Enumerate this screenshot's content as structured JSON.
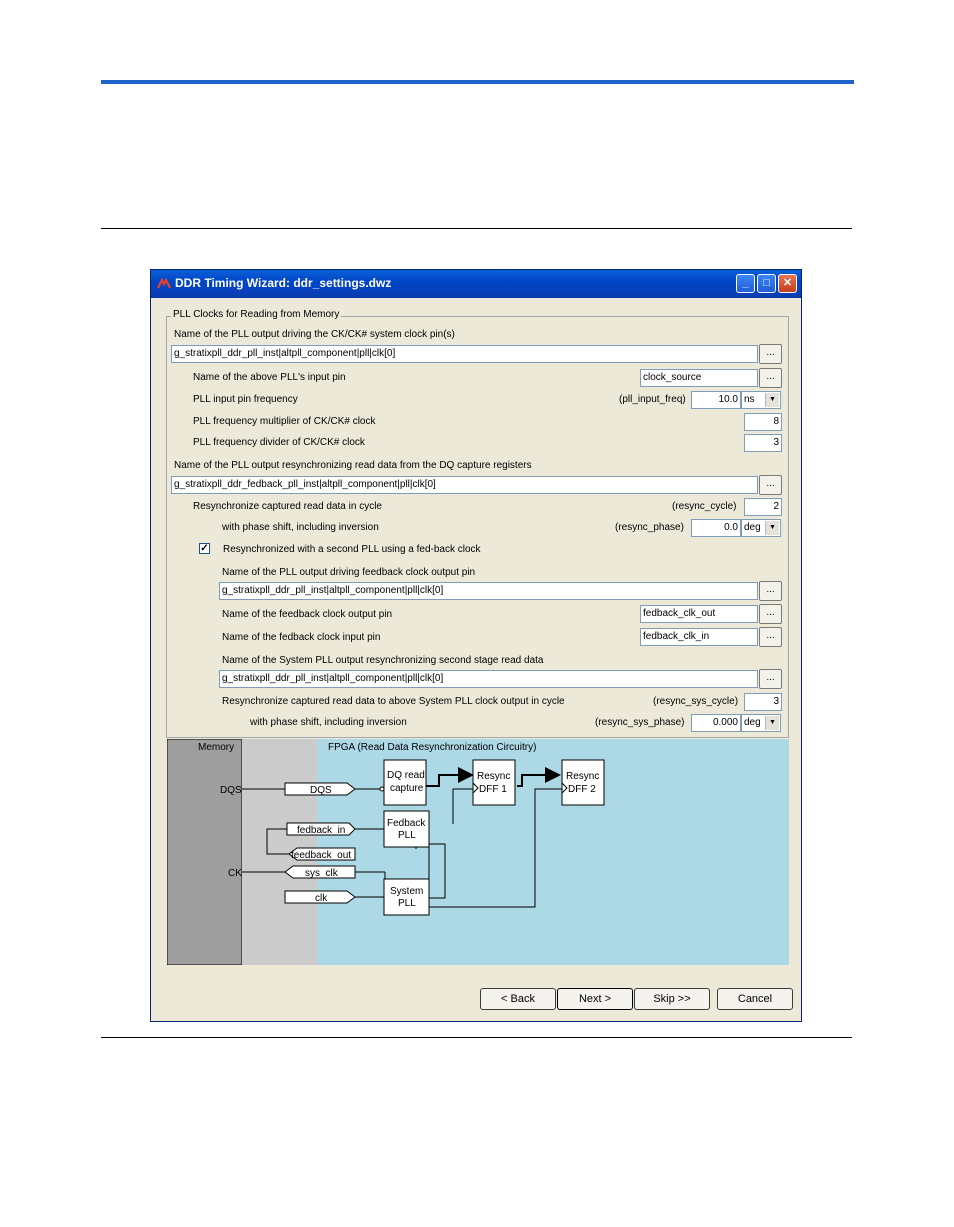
{
  "window": {
    "title": "DDR Timing Wizard: ddr_settings.dwz"
  },
  "group_title": "PLL Clocks for Reading from Memory",
  "fields": {
    "ck_label": "Name of the PLL output driving the CK/CK# system clock pin(s)",
    "ck_value": "g_stratixpll_ddr_pll_inst|altpll_component|pll|clk[0]",
    "input_pin_label": "Name of the above PLL's input pin",
    "input_pin_value": "clock_source",
    "freq_label": "PLL input pin frequency",
    "freq_var": "(pll_input_freq)",
    "freq_value": "10.0",
    "freq_unit": "ns",
    "mult_label": "PLL frequency multiplier of CK/CK# clock",
    "mult_value": "8",
    "div_label": "PLL frequency divider of CK/CK# clock",
    "div_value": "3",
    "resync_label": "Name of the PLL output resynchronizing read data from the DQ capture registers",
    "resync_value": "g_stratixpll_ddr_fedback_pll_inst|altpll_component|pll|clk[0]",
    "cycle_label": "Resynchronize captured read data in cycle",
    "cycle_var": "(resync_cycle)",
    "cycle_value": "2",
    "phase_label": "with phase shift, including inversion",
    "phase_var": "(resync_phase)",
    "phase_value": "0.0",
    "phase_unit": "deg",
    "second_pll_label": "Resynchronized with a second PLL using a fed-back clock",
    "second_pll_checked": true,
    "fb_out_label": "Name of the PLL output driving feedback clock output pin",
    "fb_out_value": "g_stratixpll_ddr_pll_inst|altpll_component|pll|clk[0]",
    "fb_clk_out_label": "Name of the feedback clock output pin",
    "fb_clk_out_value": "fedback_clk_out",
    "fb_clk_in_label": "Name of the fedback clock input pin",
    "fb_clk_in_value": "fedback_clk_in",
    "sys_label": "Name of the System PLL output resynchronizing second stage read data",
    "sys_value": "g_stratixpll_ddr_pll_inst|altpll_component|pll|clk[0]",
    "sys_cycle_label": "Resynchronize captured read data to above System PLL clock output in cycle",
    "sys_cycle_var": "(resync_sys_cycle)",
    "sys_cycle_value": "3",
    "sys_phase_label": "with phase shift, including inversion",
    "sys_phase_var": "(resync_sys_phase)",
    "sys_phase_value": "0.000",
    "sys_phase_unit": "deg",
    "ellipsis": "..."
  },
  "diagram": {
    "memory_label": "Memory",
    "fpga_label": "FPGA (Read Data Resynchronization Circuitry)",
    "dqs_pin": "DQS",
    "ck_pin": "CK",
    "sig_dqs": "DQS",
    "sig_fedback_in": "fedback_in",
    "sig_feedback_out": "feedback_out",
    "sig_sys_clk": "sys_clk",
    "sig_clk": "clk",
    "dq_capture_1": "DQ read",
    "dq_capture_2": "capture",
    "fedback_pll_1": "Fedback",
    "fedback_pll_2": "PLL",
    "system_pll_1": "System",
    "system_pll_2": "PLL",
    "dff1_1": "Resync",
    "dff1_2": "DFF 1",
    "dff2_1": "Resync",
    "dff2_2": "DFF 2",
    "colors": {
      "memory": "#9e9e9e",
      "io": "#cbcbcb",
      "fpga": "#add8e6"
    }
  },
  "buttons": {
    "back": "< Back",
    "next": "Next >",
    "skip": "Skip >>",
    "cancel": "Cancel"
  }
}
